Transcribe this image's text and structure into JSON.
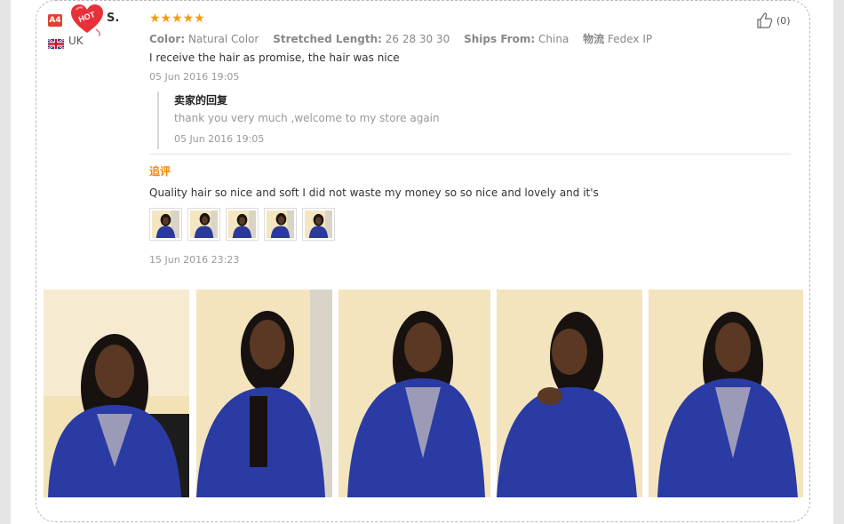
{
  "review": {
    "badge": "A4",
    "reviewer_name": "S.",
    "country": "UK",
    "rating_stars": "★★★★★",
    "attributes": [
      {
        "label": "Color:",
        "value": "Natural Color"
      },
      {
        "label": "Stretched Length:",
        "value": "26 28 30 30"
      },
      {
        "label": "Ships From:",
        "value": "China"
      },
      {
        "label": "物流",
        "value": "Fedex IP"
      }
    ],
    "text": "I receive the hair as promise, the hair was nice",
    "date": "05 Jun 2016 19:05",
    "likes": "(0)"
  },
  "seller_reply": {
    "title": "卖家的回复",
    "text": "thank you very much ,welcome to my store again",
    "date": "05 Jun 2016 19:05"
  },
  "followup": {
    "title": "追评",
    "text": "Quality hair so nice and soft I did not waste my money so so nice and lovely and it's",
    "date": "15 Jun 2016 23:23",
    "thumbnail_count": 5
  },
  "colors": {
    "accent_orange": "#f08a00",
    "star": "#f39c12",
    "badge_red": "#e0412d"
  }
}
